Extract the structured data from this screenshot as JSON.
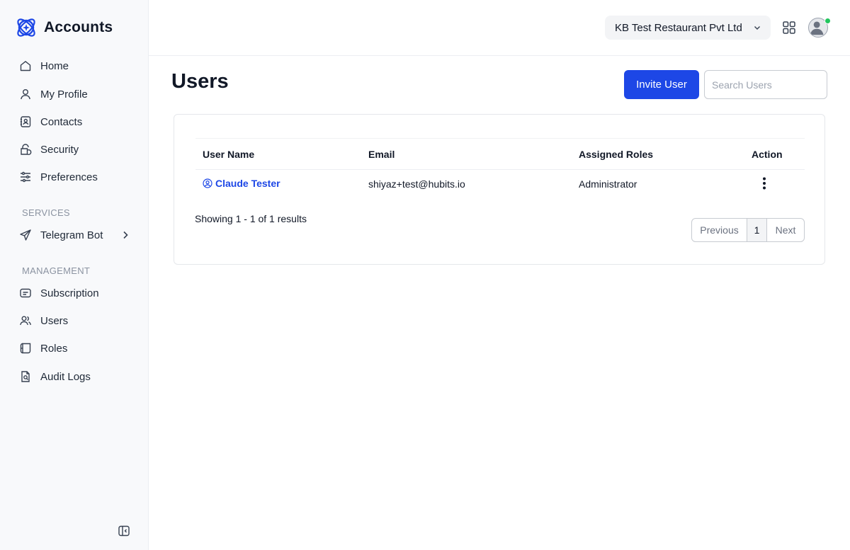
{
  "app": {
    "title": "Accounts"
  },
  "sidebar": {
    "items": [
      {
        "label": "Home",
        "icon": "home-icon"
      },
      {
        "label": "My Profile",
        "icon": "user-icon"
      },
      {
        "label": "Contacts",
        "icon": "contacts-icon"
      },
      {
        "label": "Security",
        "icon": "security-icon"
      },
      {
        "label": "Preferences",
        "icon": "sliders-icon"
      }
    ],
    "services_title": "SERVICES",
    "services": [
      {
        "label": "Telegram Bot",
        "icon": "send-icon"
      }
    ],
    "management_title": "MANAGEMENT",
    "management": [
      {
        "label": "Subscription",
        "icon": "subscription-icon"
      },
      {
        "label": "Users",
        "icon": "users-icon"
      },
      {
        "label": "Roles",
        "icon": "roles-icon"
      },
      {
        "label": "Audit Logs",
        "icon": "audit-log-icon"
      }
    ]
  },
  "header": {
    "organization": "KB Test Restaurant Pvt Ltd",
    "apps_icon": "apps-grid-icon",
    "avatar_icon": "user-avatar-icon",
    "status_color": "#22c55e"
  },
  "page": {
    "title": "Users",
    "invite_button": "Invite User",
    "search_placeholder": "Search Users",
    "search_value": ""
  },
  "table": {
    "columns": [
      "User Name",
      "Email",
      "Assigned Roles",
      "Action"
    ],
    "rows": [
      {
        "name": "Claude Tester",
        "email": "shiyaz+test@hubits.io",
        "roles": "Administrator",
        "action_icon": "more-vertical-icon"
      }
    ]
  },
  "footer": {
    "results": "Showing 1 - 1 of 1 results",
    "pagination": {
      "previous": "Previous",
      "current": "1",
      "next": "Next"
    }
  },
  "colors": {
    "accent": "#1d47e6",
    "sidebar_bg": "#f8f9fb",
    "section_title": "#8b93a1"
  }
}
